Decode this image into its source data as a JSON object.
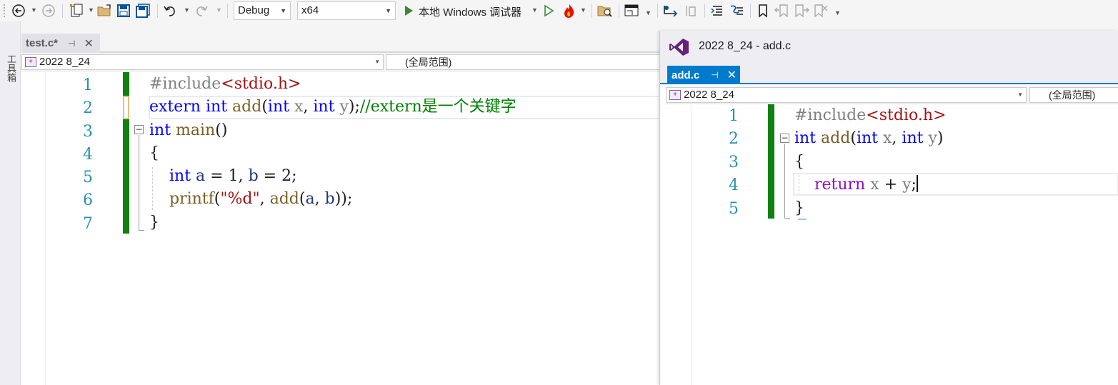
{
  "toolbar": {
    "config": "Debug",
    "platform": "x64",
    "run_label": "本地 Windows 调试器",
    "icons": [
      "back-icon",
      "forward-icon",
      "new-project-icon",
      "open-file-icon",
      "save-icon",
      "save-all-icon",
      "undo-icon",
      "redo-icon",
      "start-icon",
      "start-without-debug-icon",
      "hot-reload-icon",
      "solution-explorer-icon",
      "window-layout-icon",
      "step-icon",
      "indent-icon",
      "outdent-icon",
      "comment-icon",
      "uncomment-icon",
      "bookmark-icon",
      "prev-bookmark-icon",
      "next-bookmark-icon",
      "clear-bookmarks-icon"
    ]
  },
  "toolbox": {
    "label": "工具箱"
  },
  "left_editor": {
    "tab_label": "test.c*",
    "project": "2022 8_24",
    "scope": "(全局范围)",
    "line_numbers": [
      "1",
      "2",
      "3",
      "4",
      "5",
      "6",
      "7"
    ]
  },
  "right_window": {
    "title": "2022 8_24 - add.c",
    "tab_label": "add.c",
    "project": "2022 8_24",
    "scope": "(全局范围)",
    "line_numbers": [
      "1",
      "2",
      "3",
      "4",
      "5"
    ]
  },
  "colors": {
    "keyword": "#0000ff",
    "string": "#a31515",
    "comment": "#008000",
    "line_number": "#2b91af",
    "change_bar": "#108010",
    "active_tab": "#007acc",
    "vs_logo": "#68217a"
  }
}
